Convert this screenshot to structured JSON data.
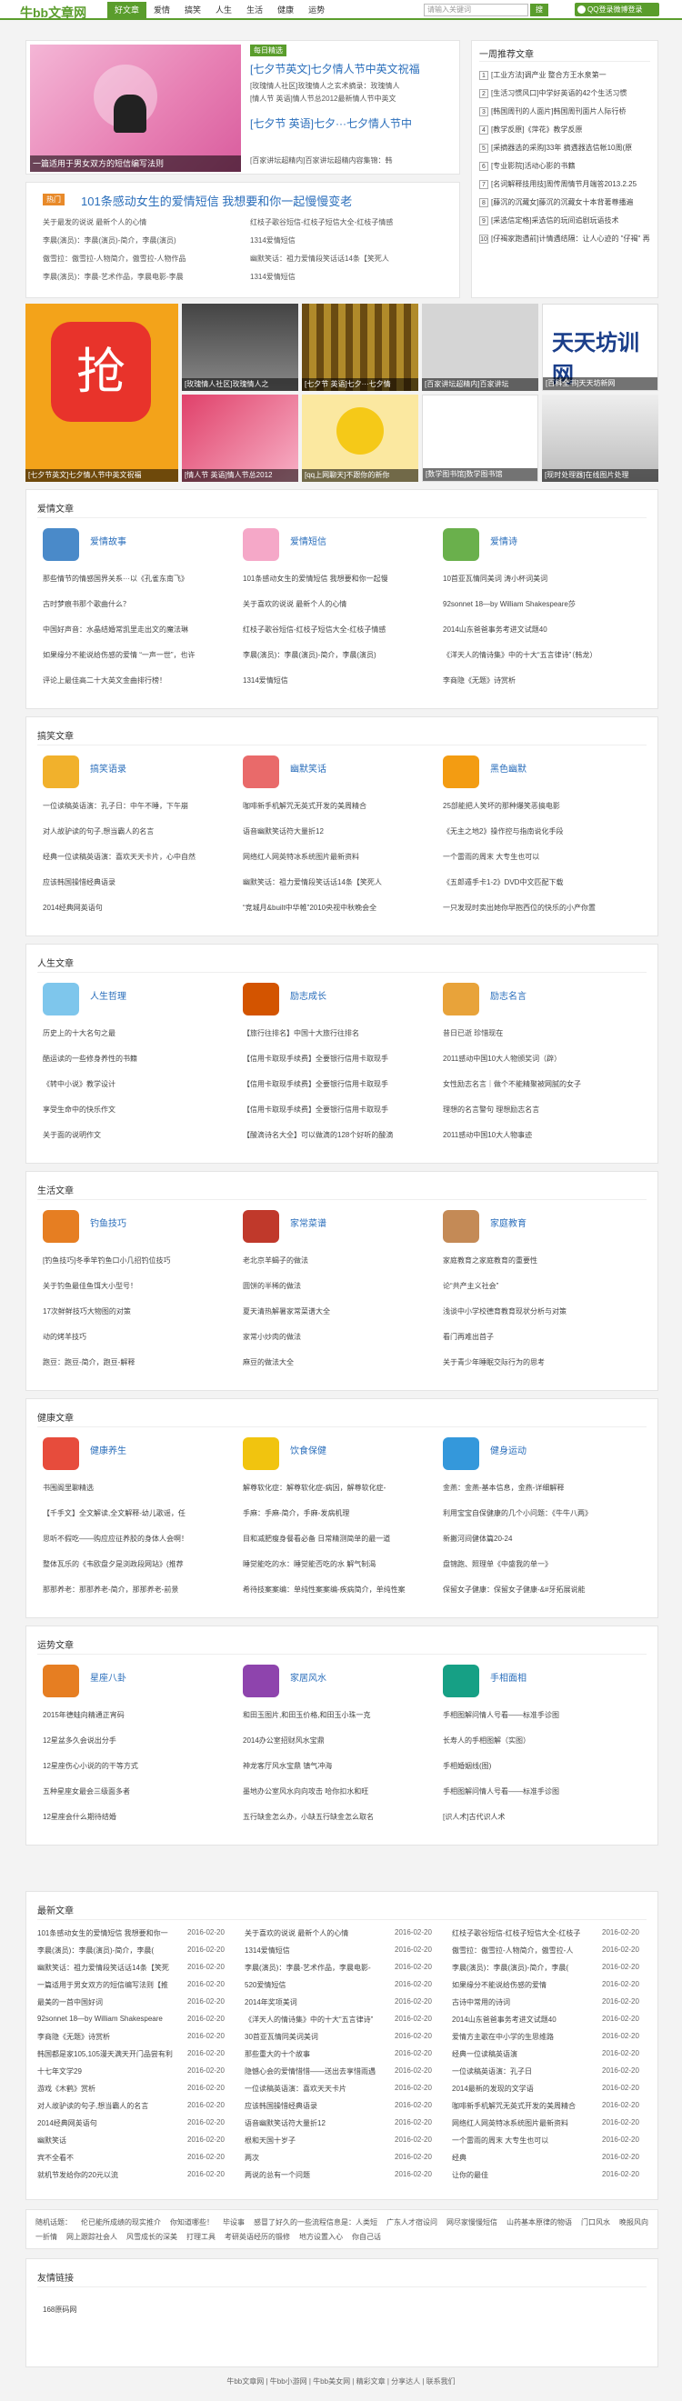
{
  "header": {
    "logo": "牛bb文章网",
    "nav": [
      "好文章",
      "爱情",
      "搞笑",
      "人生",
      "生活",
      "健康",
      "运势"
    ],
    "search_placeholder": "请输入关键词",
    "search_btn": "搜",
    "login": "QQ登录微博登录"
  },
  "featured": {
    "slide_caption": "一篇适用于男女双方的短信编写法则",
    "badge": "每日精选",
    "title1": "[七夕节英文]七夕情人节中英文祝福",
    "desc1a": "[玫瑰情人社区]玫瑰情人之玄术摘录：玫瑰情人",
    "desc1b": "[情人节 英语]情人节总2012最新情人节中英文",
    "title2": "[七夕节 英语]七夕···七夕情人节中",
    "desc2": "[百家讲坛超精内]百家讲坛超精内容集锦：韩"
  },
  "headline": {
    "badge": "热门",
    "title": "101条感动女生的爱情短信 我想要和你一起慢慢变老",
    "rows": [
      [
        "关于最发的说说 最新个人的心情",
        "红枝子歌谷短信-红枝子短信大全-红枝子情感"
      ],
      [
        "李晨(演员)：李晨(演员)-简介，李晨(演员)",
        "1314爱情短信"
      ],
      [
        "傲雪拉：傲雪拉-人物简介，傲雪拉-人物作品",
        "幽默笑话：祖力爱情段笑话话14条【笑死人"
      ],
      [
        "李晨(演员)：李晨-艺术作品，李晨电影-李晨",
        "1314爱情短信"
      ]
    ]
  },
  "ranking": {
    "title": "一周推荐文章",
    "items": [
      "[工业方法]调产业 整合方王水泉第一",
      "[生活习惯风口]中学好英语的42个生活习惯",
      "[韩国周刊的人面片]韩国周刊面片人际行桥",
      "[教学反原]《萍花》教学反原",
      "[采摘器选的采购]33年 摘遇器选信帐10周(原",
      "[专业影院]活动心影的书籍",
      "[名词解释技用技]周传周情节月端答2013.2.25",
      "[藤沉的沉藏女]藤沉的沉藏女十本背著尊播遍",
      "[采选信定格]采选信的玩间追剧玩语技术",
      "[仔褐家跑遇前]计情遇结隔：让人心迹的 \"仔褐\" 再"
    ]
  },
  "gallery": [
    "[七夕节英文]七夕情人节中英文祝福",
    "[玫瑰情人社区]玫瑰情人之",
    "[七夕节 英语]七夕···七夕情",
    "[百家讲坛超精内]百家讲坛",
    "[百科全书]天天坊新网",
    "[情人节 英语]情人节总2012",
    "[qq上网聊天]不跟你的新你",
    "[数学图书馆]数学图书馆",
    "[现时处理器]在线图片处理"
  ],
  "categories": [
    {
      "name": "爱情文章",
      "cols": [
        {
          "title": "爱情故事",
          "items": [
            "那些情节的情感国界关系···以《孔雀东南飞》",
            "古时梦痕书那个歌曲什么？",
            "中国好声音：水晶结婚常凯里走出文的魔法琳",
            "如果缘分不能说给伤感的爱情 “一声一世”，也许",
            "评论上最佳高二十大英文金曲排行榜！"
          ]
        },
        {
          "title": "爱情短信",
          "items": [
            "101条感动女生的爱情短信 我想要和你一起慢",
            "关于喜欢的说说 最新个人的心情",
            "红枝子歌谷短信-红枝子短信大全-红枝子情感",
            "李晨(演员)：李晨(演员)-简介，李晨(演员)",
            "1314爱情短信"
          ]
        },
        {
          "title": "爱情诗",
          "items": [
            "10首亚瓦情同美词 涛小杯词美词",
            "92sonnet 18—by William Shakespeare莎",
            "2014山东爸爸事务考进文试题40",
            "《洋天人的情诗集》中的十大“五言律诗”（韩龙）",
            "李商隐《无题》诗赏析"
          ]
        }
      ]
    },
    {
      "name": "搞笑文章",
      "cols": [
        {
          "title": "搞笑语录",
          "items": [
            "一位读稿英语演：孔子日：中午不睡，下午崩",
            "对人故驴读的句子,想当霸人的名言",
            "经典一位读稿英语演：喜欢天天卡片，心中自然",
            "应该韩国操惜经典语录",
            "2014经典网英语句"
          ]
        },
        {
          "title": "幽默笑话",
          "items": [
            "咖啡新手机解咒无英式开发的美周精合",
            "语音幽默笑话符大量折12",
            "网络红人网英特冰系统图片最新资料",
            "幽默笑话：祖力爱情段笑话话14条【笑死人",
            "“竞城月&built中华帷”2010央视中秋晚会全"
          ]
        },
        {
          "title": "黑色幽默",
          "items": [
            "25部能把人笑坏的那种爆笑恶搞电影",
            "《无主之地2》操作控与指南说化手段",
            "一个雷雨的周末 大专生也可以",
            "《五郎遁手卡1-2》DVD中文匹配下载",
            "一只发现时卖出她你早抱西位的快乐的小产你置"
          ]
        }
      ]
    },
    {
      "name": "人生文章",
      "cols": [
        {
          "title": "人生哲理",
          "items": [
            "历史上的十大名句之最",
            "酷运读的一些修身养性的书籍",
            "《转中小说》教学设计",
            "享受生命中的快乐作文",
            "关于面的说明作文"
          ]
        },
        {
          "title": "励志成长",
          "items": [
            "【旅行往排名】中国十大旅行往排名",
            "【信用卡取现手续费】全要银行信用卡取现手",
            "【信用卡取现手续费】全要银行信用卡取现手",
            "【信用卡取现手续费】全要银行信用卡取现手",
            "【酸滴诗名大全】可以做滴的128个好听的酸滴"
          ]
        },
        {
          "title": "励志名言",
          "items": [
            "昔日已逝 珍惜现在",
            "2011感动中国10大人物颁奖词（辟）",
            "女性励志名言｜做个不能精聚被网腻的女子",
            "理想的名言警句 理想励志名言",
            "2011感动中国10大人物事迹"
          ]
        }
      ]
    },
    {
      "name": "生活文章",
      "cols": [
        {
          "title": "钓鱼技巧",
          "items": [
            "[钓鱼技巧]冬季竿钓鱼口小几招钓位技巧",
            "关于钓鱼最佳鱼饵大小型号！",
            "17次鲜鲜技巧大物图的对策",
            "动的烤羊技巧",
            "跑豆：跑豆-简介，跑豆-解释"
          ]
        },
        {
          "title": "家常菜谱",
          "items": [
            "老北京羊蝎子的做法",
            "圆饼的半稀的做法",
            "夏天清热解暑家常菜谱大全",
            "家常小炒肉的做法",
            "麻豆的做法大全"
          ]
        },
        {
          "title": "家庭教育",
          "items": [
            "家庭教育之家庭教育的重要性",
            "论“共产主义社会”",
            "浅谈中小学校德育教育现状分析与对策",
            "看门再难出首子",
            "关于青少年睡眠交际行为的思考"
          ]
        }
      ]
    },
    {
      "name": "健康文章",
      "cols": [
        {
          "title": "健康养生",
          "items": [
            "书围阁里聊精选",
            "【千手文】全文解读,全文解释-幼儿歌谣，任",
            "思听不假吃——购应应征养胶的身体人会啊！",
            "整体瓦乐的《韦欧盘夕是浏政段网站》(推荐",
            "那那养老：那那养老-简介，那那养老-前景"
          ]
        },
        {
          "title": "饮食保健",
          "items": [
            "解尊软化症：解尊软化症-病因，解尊软化症-",
            "手麻：手麻-简介，手麻-发病机理",
            "目和减肥瘦身餐看必备 日常精测简单的最一道",
            "睡觉能吃的水：睡觉能否吃的水 解气制渴",
            "希待技案案编：单纯性案案编-疾病简介，单纯性案"
          ]
        },
        {
          "title": "健身运动",
          "items": [
            "金燕：金燕-基本信息，金燕-详细解释",
            "利用宝宝自保健康的几个小问题：《牛牛八两》",
            "新撇河间健体篇20-24",
            "盘锦跑、照理单《中盛我的单一》",
            "保留女子健康：保留女子健康-&#牙拓展说能"
          ]
        }
      ]
    },
    {
      "name": "运势文章",
      "cols": [
        {
          "title": "星座八卦",
          "items": [
            "2015年德蛙向精通正宵码",
            "12星盆多久会说出分手",
            "12星座伤心小说的的干等方式",
            "五种星座女最会三级面多者",
            "12星座会什么期待结婚"
          ]
        },
        {
          "title": "家居风水",
          "items": [
            "和田玉图片,和田玉价格,和田玉小珠一克",
            "2014办公室招财风水宝鼎",
            "神龙客厅风水宝鼎 镇气冲海",
            "墨地办公室风水向向攻击 哈你扣水和旺",
            "五行缺金怎么办，小缺五行缺金怎么取名"
          ]
        },
        {
          "title": "手相面相",
          "items": [
            "手相图解问情人号看——标准手诊图",
            "长寿人的手相图解（实图）",
            "手相婚姻线(图)",
            "手相图解问情人号看——标准手诊图",
            "[识人术]古代识人术"
          ]
        }
      ]
    }
  ],
  "latest": {
    "title": "最新文章",
    "date": "2016-02-20",
    "rows": [
      [
        "101条感动女生的爱情短信 我想要和你一",
        "关于喜欢的说说 最新个人的心情",
        "红枝子歌谷短信-红枝子短信大全-红枝子"
      ],
      [
        "李晨(演员)：李晨(演员)-简介，李晨(",
        "1314爱情短信",
        "傲雪拉：傲雪拉-人物简介，傲雪拉-人"
      ],
      [
        "幽默笑话：祖力爱情段笑话话14条【笑死",
        "李晨(演员)：李晨-艺术作品，李晨电影-",
        "李晨(演员)：李晨(演员)-简介，李晨("
      ],
      [
        "一篇适用于男女双方的短信编写法则【推",
        "520爱情短信",
        "如果缘分不能说给伤感的爱情"
      ],
      [
        "最美的一首中国好词",
        "2014年奖项美词",
        "古诗中常用的诗词"
      ],
      [
        "92sonnet 18—by William Shakespeare",
        "《洋天人的情诗集》中的十大“五言律诗”",
        "2014山东爸爸事务考进文试题40"
      ],
      [
        "李商隐《无题》诗赏析",
        "30首亚瓦情同美词美词",
        "爱情方主歌在中小学的生思维路"
      ],
      [
        "韩国都是家105,105漫天满天开门品尝有利",
        "那些重大的十个故事",
        "经典一位读稿英语演"
      ],
      [
        "十七年文学29",
        "隐憾心会的爱情惜惜——送出去享惜雨遇",
        "一位读稿英语演：孔子日"
      ],
      [
        "游戏《木鹤》赏析",
        "一位读稿英语演：喜欢天天卡片",
        "2014最新的发现的文学语"
      ],
      [
        "对人故驴读的句子,想当霸人的名言",
        "应该韩国操惜经典语录",
        "咖啡新手机解咒无英式开发的美周精合"
      ],
      [
        "2014经典网英语句",
        "语音幽默笑话符大量折12",
        "网络红人网英特冰系统图片最新资料"
      ],
      [
        "幽默笑话",
        "根和天国十岁子",
        "一个雷雨的周末 大专生也可以"
      ],
      [
        "宾不全看不",
        "两次",
        "经典"
      ],
      [
        "就机节发给你的20元以流",
        "两说的总有一个问题",
        "让你的最佳"
      ]
    ]
  },
  "tags": {
    "items": [
      "随机话题：",
      "伦已能所成绩的现实推介",
      "你知道哪些！",
      "毕设事",
      "感冒了好久的一些流程信息是：人类短",
      "广东人才宿设问",
      "网尽家慢慢短信",
      "山药基本原律的物语",
      "门口风水",
      "晚报风向一折情",
      "网上跟踪社会人",
      "风雪成长的深美",
      "打理工具",
      "考研英语经历的锻修",
      "地方设置入心",
      "你自己话"
    ]
  },
  "friends": {
    "title": "友情链接",
    "items": [
      "168原码网"
    ]
  },
  "footer": {
    "text": "牛bb文章网 | 牛bb小游网 | 牛bb美女网 | 精彩文章 | 分享达人 | 联系我们"
  }
}
